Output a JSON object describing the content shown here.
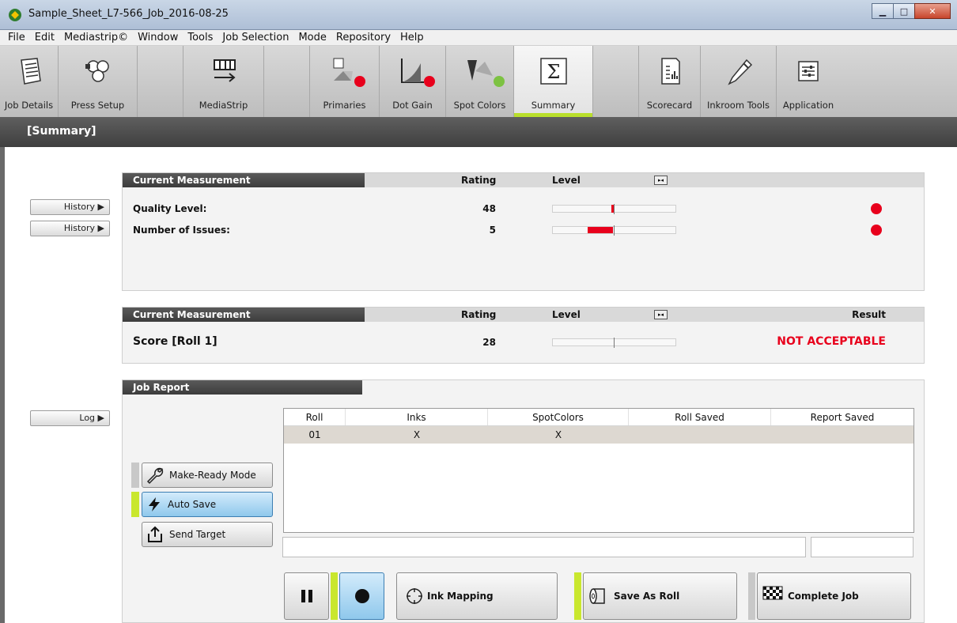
{
  "window": {
    "title": "Sample_Sheet_L7-566_Job_2016-08-25"
  },
  "menu": [
    "File",
    "Edit",
    "Mediastrip©",
    "Window",
    "Tools",
    "Job Selection",
    "Mode",
    "Repository",
    "Help"
  ],
  "toolbar": {
    "job_details": "Job Details",
    "press_setup": "Press Setup",
    "mediastrip": "MediaStrip",
    "primaries": "Primaries",
    "dot_gain": "Dot Gain",
    "spot_colors": "Spot Colors",
    "summary": "Summary",
    "scorecard": "Scorecard",
    "inkroom_tools": "Inkroom Tools",
    "application": "Application"
  },
  "status_colors": {
    "primaries": "#e8001c",
    "dot_gain": "#e8001c",
    "spot_colors": "#7dc242",
    "accent": "#b9df2c"
  },
  "section_title": "[Summary]",
  "side": {
    "history1": "History ▶",
    "history2": "History ▶",
    "log": "Log ▶"
  },
  "panel1": {
    "header": "Current Measurement",
    "rating": "Rating",
    "level": "Level",
    "rows": [
      {
        "label": "Quality Level:",
        "value": "48"
      },
      {
        "label": "Number of Issues:",
        "value": "5"
      }
    ]
  },
  "panel2": {
    "header": "Current Measurement",
    "rating": "Rating",
    "level": "Level",
    "result_header": "Result",
    "score_label": "Score [Roll 1]",
    "score_value": "28",
    "result": "NOT ACCEPTABLE"
  },
  "job_report": {
    "header": "Job Report",
    "columns": [
      "Roll",
      "Inks",
      "SpotColors",
      "Roll Saved",
      "Report Saved"
    ],
    "rows": [
      [
        "01",
        "X",
        "X",
        "",
        ""
      ]
    ]
  },
  "mode_buttons": {
    "make_ready": "Make-Ready Mode",
    "auto_save": "Auto Save",
    "send_target": "Send Target"
  },
  "actions": {
    "ink_mapping": "Ink Mapping",
    "save_as_roll": "Save As Roll",
    "complete_job": "Complete Job"
  }
}
